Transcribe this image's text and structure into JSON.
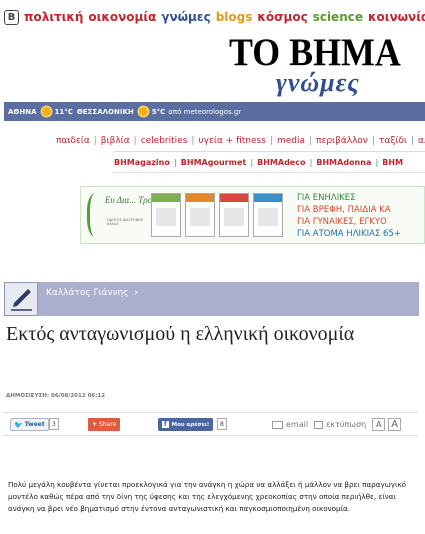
{
  "topnav": {
    "items": [
      {
        "label": "πολιτική",
        "color": "#c0262b"
      },
      {
        "label": "οικονομία",
        "color": "#c0262b"
      },
      {
        "label": "γνώμες",
        "color": "#314f8f"
      },
      {
        "label": "blogs",
        "color": "#e59a1a"
      },
      {
        "label": "κόσμος",
        "color": "#c0262b"
      },
      {
        "label": "science",
        "color": "#5c9c2e"
      },
      {
        "label": "κοινωνία",
        "color": "#c0262b"
      }
    ]
  },
  "logo": {
    "title": "ΤΟ ΒΗΜΑ",
    "subtitle": "γνώμες"
  },
  "weather": {
    "city1": "ΑΘΗΝΑ",
    "temp1": "11°C",
    "city2": "ΘΕΣΣΑΛΟΝΙΚΗ",
    "temp2": "5°C",
    "source": "από meteorologos.gr"
  },
  "sections": [
    "παιδεία",
    "βιβλία",
    "celebrities",
    "υγεία + fitness",
    "media",
    "περιβάλλον",
    "ταξίδι",
    "αλ"
  ],
  "magazines": [
    "BHMagazino",
    "BHMAgourmet",
    "BHMAdeco",
    "BHMAdonna",
    "BHM"
  ],
  "ad": {
    "brand": "Ευ Δια... Τροφήν",
    "small_text": "ΟΔΗΓΟΣ ΔΙΑΤΡΟΦΗΣ ΕΛΛΑΣ",
    "lines": [
      {
        "text": "ΓΙΑ ΕΝΗΛΙΚΕΣ",
        "color": "#2f8a3a"
      },
      {
        "text": "ΓΙΑ ΒΡΕΦΗ, ΠΑΙΔΙΑ ΚΑ",
        "color": "#d94a2b"
      },
      {
        "text": "ΓΙΑ ΓΥΝΑΙΚΕΣ, ΕΓΚΥΟ",
        "color": "#d94a2b"
      },
      {
        "text": "ΓΙΑ ΑΤΟΜΑ ΗΛΙΚΙΑΣ 65+",
        "color": "#1f6fb0"
      }
    ]
  },
  "author": {
    "name": "Καλλάτος Γιάννης",
    "chevron": "›"
  },
  "article": {
    "headline": "Εκτός ανταγωνισμού η ελληνική οικονομία",
    "pubdate": "ΔΗΜΟΣΙΕΥΣΗ:   06/08/2012 06:12",
    "body": "Πολύ μεγάλη κουβέντα γίνεται προεκλογικά για την ανάγκη η χώρα να αλλάξει ή μάλλον να βρει παραγωγικό μοντέλο καθώς πέρα από την δίνη της ύφεσης και της ελεγχόμενης χρεοκοπίας στην οποία περιήλθε, είναι ανάγκη να βρει νέο βηματισμό στην έντονα ανταγωνιστική και παγκοσμιοποιημένη οικονομία."
  },
  "share": {
    "tweet_label": "Tweet",
    "tweet_count": "3",
    "share_label": "Share",
    "fb_label": "Μου αρέσει!",
    "fb_count": "8",
    "email_label": "email",
    "print_label": "εκτύπωση",
    "font_small": "A",
    "font_large": "A"
  }
}
